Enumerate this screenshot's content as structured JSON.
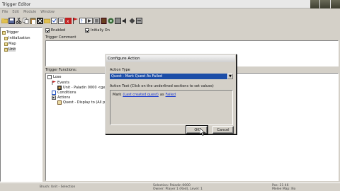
{
  "window": {
    "title": "Trigger Editor"
  },
  "menu": [
    "File",
    "Edit",
    "Module",
    "Window"
  ],
  "toolbar": {
    "icons": [
      "folder-icon",
      "save-icon",
      "cut-icon",
      "copy-icon",
      "paste-icon",
      "x-icon",
      "category-icon",
      "trigger-icon",
      "comment-icon",
      "variable-icon",
      "event-icon",
      "condition-icon",
      "action-icon",
      "test-icon",
      "book-icon",
      "module-icon",
      "import-icon",
      "sound-icon",
      "object-icon",
      "export-icon"
    ]
  },
  "tree": {
    "items": [
      "Trigger",
      "Initialization",
      "Map",
      "Unit"
    ]
  },
  "trigger": {
    "enabled_label": "Enabled",
    "initially_on_label": "Initially On",
    "comment_label": "Trigger Comment",
    "functions_label": "Trigger Functions:",
    "root": "Lose",
    "events": "Events",
    "event_item": "Unit - Paladin 0000 <gen>",
    "conditions": "Conditions",
    "actions": "Actions",
    "action_item": "Quest - Display to (All pl"
  },
  "dialog": {
    "title": "Configure Action",
    "action_type_label": "Action Type",
    "action_type_value": "Quest - Mark Quest As Failed",
    "action_text_label": "Action Text (Click on the underlined sections to set values)",
    "mark_text": "Mark",
    "quest_link": "(Last created quest)",
    "as_text": "as",
    "failed_link": "Failed",
    "ok": "OK",
    "cancel": "Cancel"
  },
  "status": {
    "left": "Brush: Unit - Selection",
    "mid_line1": "Selection: Paladin 0000",
    "mid_line2": "Owner: Player 1 (Red), Level: 1",
    "right_line1": "Pos: 21 46",
    "right_line2": "Melee Map: No"
  },
  "colors": {
    "chrome": "#d4d0c8",
    "selection": "#1c4ea8",
    "link": "#1a3ad0"
  }
}
